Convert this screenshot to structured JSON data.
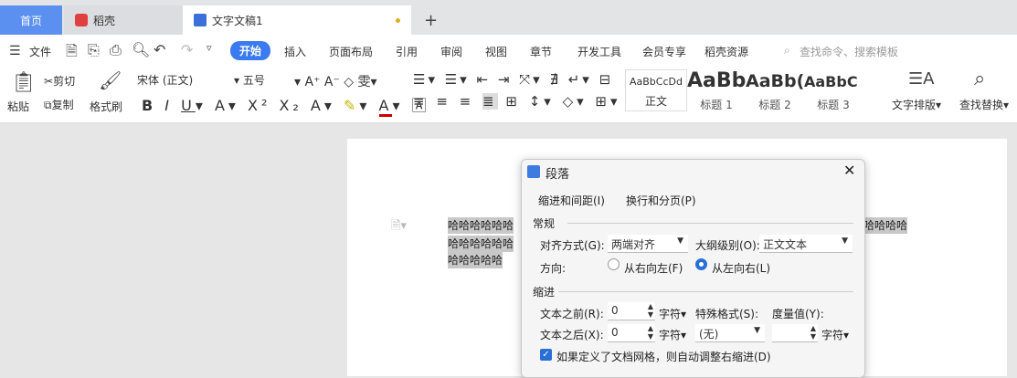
{
  "tabs": [
    {
      "label": "首页"
    },
    {
      "label": "稻壳"
    },
    {
      "label": "文字文稿1"
    }
  ],
  "new_tab": "+",
  "menu": {
    "file": "文件",
    "items": [
      "开始",
      "插入",
      "页面布局",
      "引用",
      "审阅",
      "视图",
      "章节",
      "开发工具",
      "会员专享",
      "稻壳资源"
    ],
    "search_placeholder": "查找命令、搜索模板"
  },
  "ribbon": {
    "paste": "粘贴",
    "cut": "剪切",
    "copy": "复制",
    "format_painter": "格式刷",
    "font": "宋体 (正文)",
    "size": "五号",
    "styles": [
      {
        "preview": "AaBbCcDd",
        "label": "正文"
      },
      {
        "preview": "AaBb",
        "label": "标题 1"
      },
      {
        "preview": "AaBb(",
        "label": "标题 2"
      },
      {
        "preview": "AaBbC",
        "label": "标题 3"
      }
    ],
    "text_layout": "文字排版",
    "find_replace": "查找替换"
  },
  "document": {
    "lines": [
      "哈哈哈哈哈哈",
      "哈哈哈哈哈哈",
      "哈哈哈哈哈"
    ],
    "right_text": "哈哈哈哈"
  },
  "dialog": {
    "title": "段落",
    "tabs": [
      "缩进和间距(I)",
      "换行和分页(P)"
    ],
    "general": "常规",
    "align_label": "对齐方式(G):",
    "align_value": "两端对齐",
    "outline_label": "大纲级别(O):",
    "outline_value": "正文文本",
    "direction_label": "方向:",
    "rtl": "从右向左(F)",
    "ltr": "从左向右(L)",
    "indent": "缩进",
    "before_label": "文本之前(R):",
    "before_value": "0",
    "after_label": "文本之后(X):",
    "after_value": "0",
    "unit": "字符",
    "special_label": "特殊格式(S):",
    "special_value": "(无)",
    "measure_label": "度量值(Y):",
    "measure_value": "",
    "auto_adjust": "如果定义了文档网格，则自动调整右缩进(D)"
  }
}
